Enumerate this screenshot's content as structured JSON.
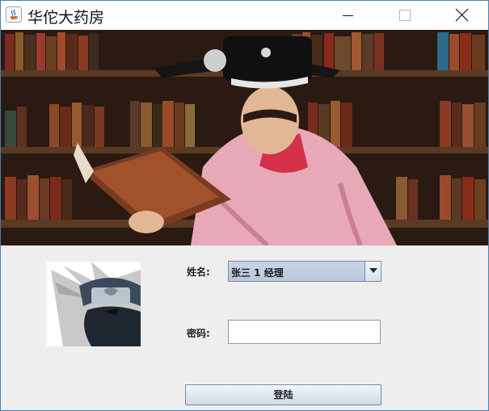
{
  "window": {
    "title": "华佗大药房"
  },
  "form": {
    "name_label": "姓名:",
    "name_selected": "张三 1 经理",
    "password_label": "密码:",
    "password_value": "",
    "login_label": "登陆"
  },
  "icons": {
    "app": "java-cup-icon",
    "minimize": "minimize-icon",
    "maximize": "maximize-icon",
    "close": "close-icon",
    "dropdown": "chevron-down-icon"
  },
  "colors": {
    "window_border": "#4a7fb5",
    "panel_background": "#eeeeee",
    "select_background": "#c0cfe0"
  }
}
